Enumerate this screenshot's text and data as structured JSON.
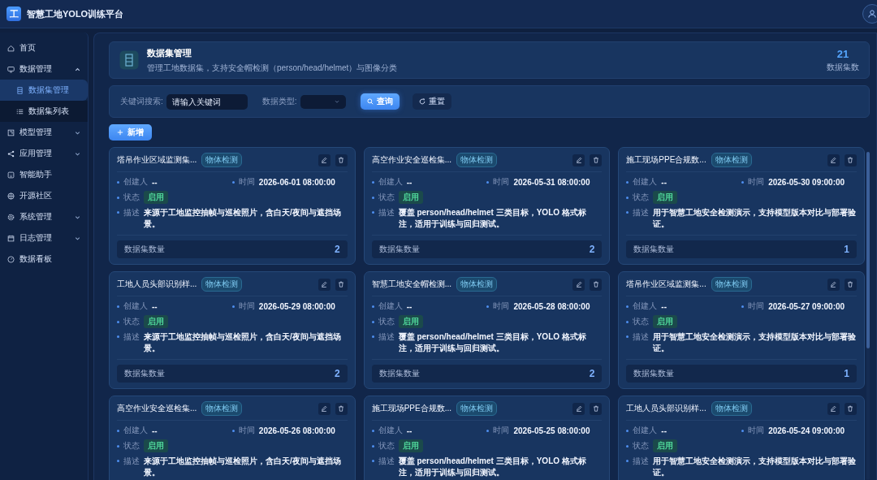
{
  "app": {
    "logo": "工",
    "title": "智慧工地YOLO训练平台"
  },
  "sidebar": {
    "items": [
      {
        "label": "首页"
      },
      {
        "label": "数据管理",
        "expanded": true,
        "children": [
          {
            "label": "数据集管理",
            "selected": true
          },
          {
            "label": "数据集列表",
            "selected": false
          }
        ]
      },
      {
        "label": "模型管理",
        "expanded": false
      },
      {
        "label": "应用管理",
        "expanded": false
      },
      {
        "label": "智能助手"
      },
      {
        "label": "开源社区"
      },
      {
        "label": "系统管理",
        "expanded": false
      },
      {
        "label": "日志管理",
        "expanded": false
      },
      {
        "label": "数据看板"
      }
    ]
  },
  "header": {
    "title": "数据集管理",
    "subtitle": "管理工地数据集，支持安全帽检测（person/head/helmet）与图像分类",
    "stat_value": "21",
    "stat_label": "数据集数"
  },
  "filters": {
    "keyword_label": "关键词搜索:",
    "keyword_placeholder": "请输入关键词",
    "type_label": "数据类型:",
    "query_button": "查询",
    "reset_button": "重置"
  },
  "new_button": "新增",
  "cards": [
    {
      "title": "塔吊作业区域监测集...",
      "tag": "物体检测",
      "creator_label": "创建人",
      "creator": "--",
      "time_label": "时间",
      "time": "2026-06-01 08:00:00",
      "status_label": "状态",
      "status": "启用",
      "desc_label": "描述",
      "desc": "来源于工地监控抽帧与巡检照片，含白天/夜间与遮挡场景。",
      "count_label": "数据集数量",
      "count": "2"
    },
    {
      "title": "高空作业安全巡检集...",
      "tag": "物体检测",
      "creator_label": "创建人",
      "creator": "--",
      "time_label": "时间",
      "time": "2026-05-31 08:00:00",
      "status_label": "状态",
      "status": "启用",
      "desc_label": "描述",
      "desc": "覆盖 person/head/helmet 三类目标，YOLO 格式标注，适用于训练与回归测试。",
      "count_label": "数据集数量",
      "count": "2"
    },
    {
      "title": "施工现场PPE合规数...",
      "tag": "物体检测",
      "creator_label": "创建人",
      "creator": "--",
      "time_label": "时间",
      "time": "2026-05-30 09:00:00",
      "status_label": "状态",
      "status": "启用",
      "desc_label": "描述",
      "desc": "用于智慧工地安全检测演示，支持模型版本对比与部署验证。",
      "count_label": "数据集数量",
      "count": "1"
    },
    {
      "title": "工地人员头部识别样...",
      "tag": "物体检测",
      "creator_label": "创建人",
      "creator": "--",
      "time_label": "时间",
      "time": "2026-05-29 08:00:00",
      "status_label": "状态",
      "status": "启用",
      "desc_label": "描述",
      "desc": "来源于工地监控抽帧与巡检照片，含白天/夜间与遮挡场景。",
      "count_label": "数据集数量",
      "count": "2"
    },
    {
      "title": "智慧工地安全帽检测...",
      "tag": "物体检测",
      "creator_label": "创建人",
      "creator": "--",
      "time_label": "时间",
      "time": "2026-05-28 08:00:00",
      "status_label": "状态",
      "status": "启用",
      "desc_label": "描述",
      "desc": "覆盖 person/head/helmet 三类目标，YOLO 格式标注，适用于训练与回归测试。",
      "count_label": "数据集数量",
      "count": "2"
    },
    {
      "title": "塔吊作业区域监测集...",
      "tag": "物体检测",
      "creator_label": "创建人",
      "creator": "--",
      "time_label": "时间",
      "time": "2026-05-27 09:00:00",
      "status_label": "状态",
      "status": "启用",
      "desc_label": "描述",
      "desc": "用于智慧工地安全检测演示，支持模型版本对比与部署验证。",
      "count_label": "数据集数量",
      "count": "1"
    },
    {
      "title": "高空作业安全巡检集...",
      "tag": "物体检测",
      "creator_label": "创建人",
      "creator": "--",
      "time_label": "时间",
      "time": "2026-05-26 08:00:00",
      "status_label": "状态",
      "status": "启用",
      "desc_label": "描述",
      "desc": "来源于工地监控抽帧与巡检照片，含白天/夜间与遮挡场景。"
    },
    {
      "title": "施工现场PPE合规数...",
      "tag": "物体检测",
      "creator_label": "创建人",
      "creator": "--",
      "time_label": "时间",
      "time": "2026-05-25 08:00:00",
      "status_label": "状态",
      "status": "启用",
      "desc_label": "描述",
      "desc": "覆盖 person/head/helmet 三类目标，YOLO 格式标注，适用于训练与回归测试。"
    },
    {
      "title": "工地人员头部识别样...",
      "tag": "物体检测",
      "creator_label": "创建人",
      "creator": "--",
      "time_label": "时间",
      "time": "2026-05-24 09:00:00",
      "status_label": "状态",
      "status": "启用",
      "desc_label": "描述",
      "desc": "用于智慧工地安全检测演示，支持模型版本对比与部署验证。"
    }
  ]
}
